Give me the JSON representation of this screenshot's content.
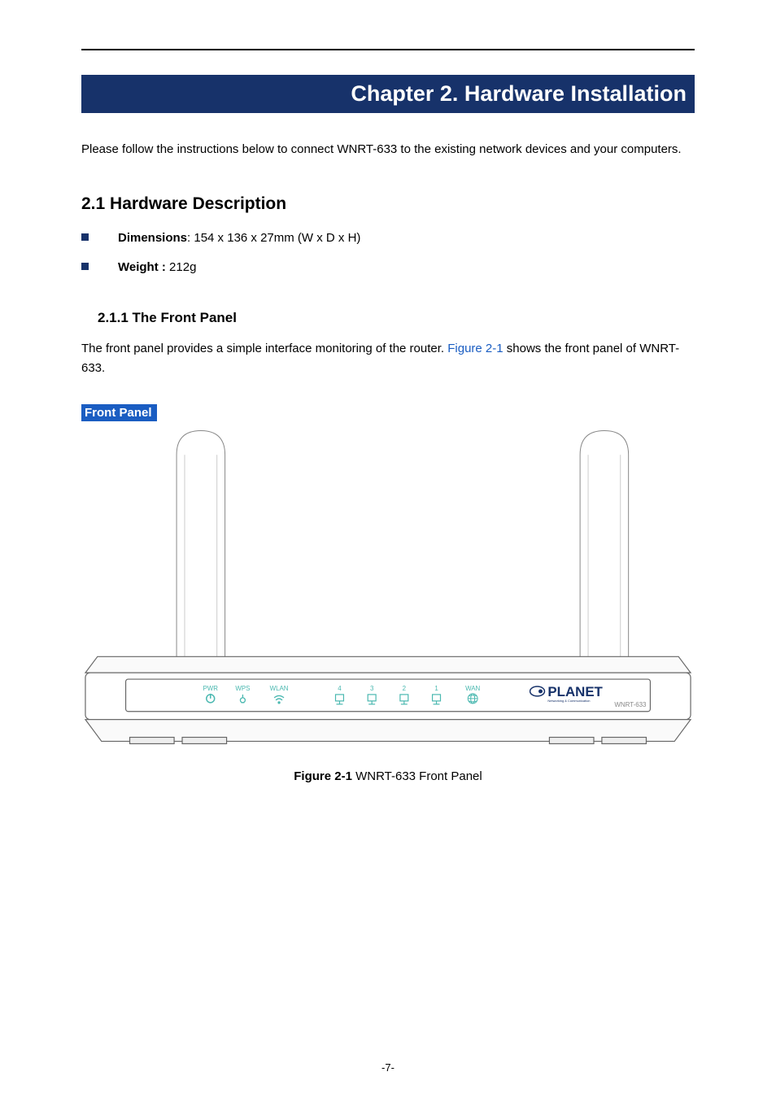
{
  "chapter": {
    "title": "Chapter 2. Hardware Installation"
  },
  "intro": "Please follow the instructions below to connect WNRT-633 to the existing network devices and your computers.",
  "section21": {
    "heading": "2.1  Hardware Description",
    "dimensions_label": "Dimensions",
    "dimensions_value": ": 154 x 136 x 27mm (W x D x H)",
    "weight_label": "Weight :",
    "weight_value": " 212g"
  },
  "section211": {
    "heading": "2.1.1  The Front Panel",
    "text_pre": "The front panel provides a simple interface monitoring of the router. ",
    "fig_ref": "Figure 2-1",
    "text_post": " shows the front panel of WNRT-633."
  },
  "front_panel_label": "Front Panel",
  "device": {
    "leds": {
      "pwr": "PWR",
      "wps": "WPS",
      "wlan": "WLAN",
      "p4": "4",
      "p3": "3",
      "p2": "2",
      "p1": "1",
      "wan": "WAN"
    },
    "brand": "PLANET",
    "brand_sub": "Networking & Communication",
    "model": "WNRT-633"
  },
  "figure_caption_bold": "Figure 2-1",
  "figure_caption_rest": " WNRT-633 Front Panel",
  "page_number": "-7-"
}
